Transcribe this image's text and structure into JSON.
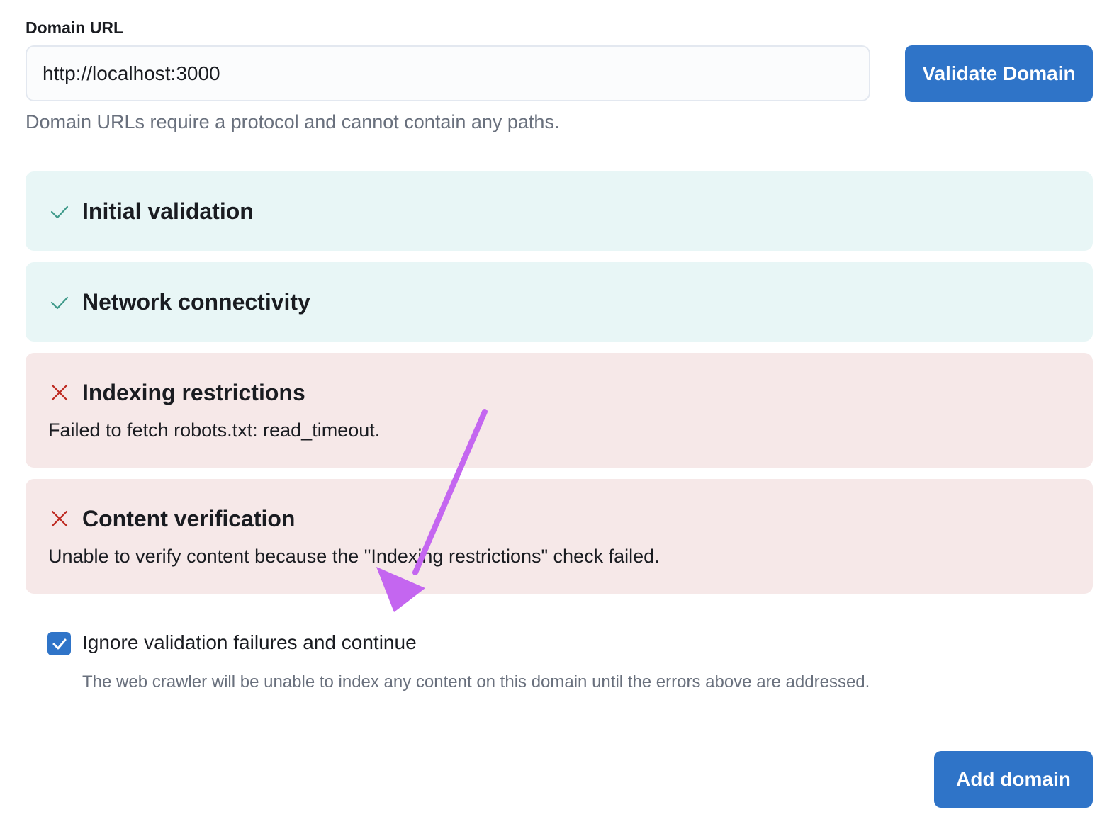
{
  "form": {
    "domain_label": "Domain URL",
    "domain_value": "http://localhost:3000",
    "validate_button": "Validate Domain",
    "help_text": "Domain URLs require a protocol and cannot contain any paths."
  },
  "checks": [
    {
      "status": "success",
      "icon": "check-icon",
      "title": "Initial validation",
      "message": ""
    },
    {
      "status": "success",
      "icon": "check-icon",
      "title": "Network connectivity",
      "message": ""
    },
    {
      "status": "error",
      "icon": "cross-icon",
      "title": "Indexing restrictions",
      "message": "Failed to fetch robots.txt: read_timeout."
    },
    {
      "status": "error",
      "icon": "cross-icon",
      "title": "Content verification",
      "message": "Unable to verify content because the \"Indexing restrictions\" check failed."
    }
  ],
  "ignore_failures": {
    "checked": true,
    "label": "Ignore validation failures and continue",
    "help": "The web crawler will be unable to index any content on this domain until the errors above are addressed."
  },
  "footer": {
    "add_button": "Add domain"
  },
  "colors": {
    "primary": "#2f74c8",
    "success_bg": "#e8f6f6",
    "success_icon": "#3f9a8a",
    "danger_bg": "#f6e8e8",
    "danger_icon": "#bd271e",
    "annotation": "#c466f0"
  }
}
